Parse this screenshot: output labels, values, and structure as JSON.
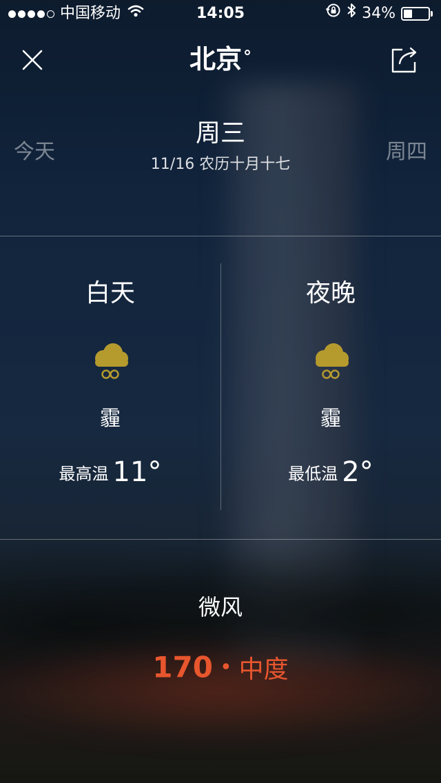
{
  "status_bar": {
    "carrier": "中国移动",
    "time": "14:05",
    "battery_percent_label": "34%",
    "battery_level": 0.34,
    "signal_bars_filled": 4,
    "signal_bars_total": 5
  },
  "header": {
    "city": "北京",
    "city_suffix": "°"
  },
  "day_nav": {
    "prev_label": "今天",
    "current_weekday": "周三",
    "date_text": "11/16 农历十月十七",
    "next_label": "周四"
  },
  "daytime": {
    "title": "白天",
    "icon": "haze-icon",
    "condition": "霾",
    "temp_label": "最高温",
    "temp_value": "11°"
  },
  "night": {
    "title": "夜晚",
    "icon": "haze-icon",
    "condition": "霾",
    "temp_label": "最低温",
    "temp_value": "2°"
  },
  "wind": {
    "text": "微风"
  },
  "air_quality": {
    "value": "170",
    "separator": "•",
    "level": "中度"
  },
  "colors": {
    "aqi_color": "#e8562e",
    "icon_color": "#b59a2e"
  }
}
